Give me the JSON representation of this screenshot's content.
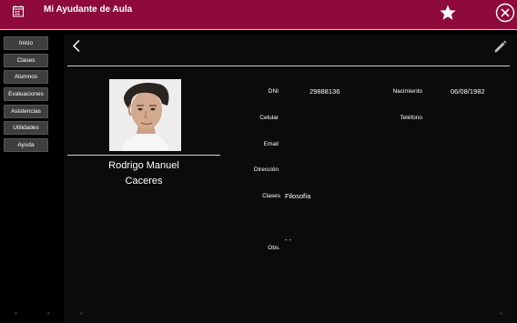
{
  "app": {
    "title": "Mi Ayudante de Aula"
  },
  "sidebar": {
    "items": [
      {
        "label": "Inicio"
      },
      {
        "label": "Clases"
      },
      {
        "label": "Alumnos"
      },
      {
        "label": "Evaluaciones"
      },
      {
        "label": "Asistencias"
      },
      {
        "label": "Utilidades"
      },
      {
        "label": "Ayuda"
      }
    ]
  },
  "student": {
    "first_name": "Rodrigo Manuel",
    "last_name": "Caceres",
    "fields": {
      "dni": {
        "label": "DNI",
        "value": "29888136"
      },
      "nacimiento": {
        "label": "Nacimiento",
        "value": "06/08/1982"
      },
      "celular": {
        "label": "Celular",
        "value": ""
      },
      "telefono": {
        "label": "Teléfono",
        "value": ""
      },
      "email": {
        "label": "Email",
        "value": ""
      },
      "direccion": {
        "label": "Dirección",
        "value": ""
      },
      "clases": {
        "label": "Clases",
        "value": "Filosofía"
      },
      "obs": {
        "label": "Obs.",
        "value": "- -"
      }
    }
  },
  "colors": {
    "titlebar": "#8e0a3c",
    "background": "#000000",
    "panel": "#0b0b0b",
    "nav_button": "#3e3e3e"
  },
  "icons": {
    "app": "calendar-icon",
    "favorite": "star-icon",
    "close": "close-circle-icon",
    "back": "chevron-left-icon",
    "edit": "pencil-icon"
  }
}
